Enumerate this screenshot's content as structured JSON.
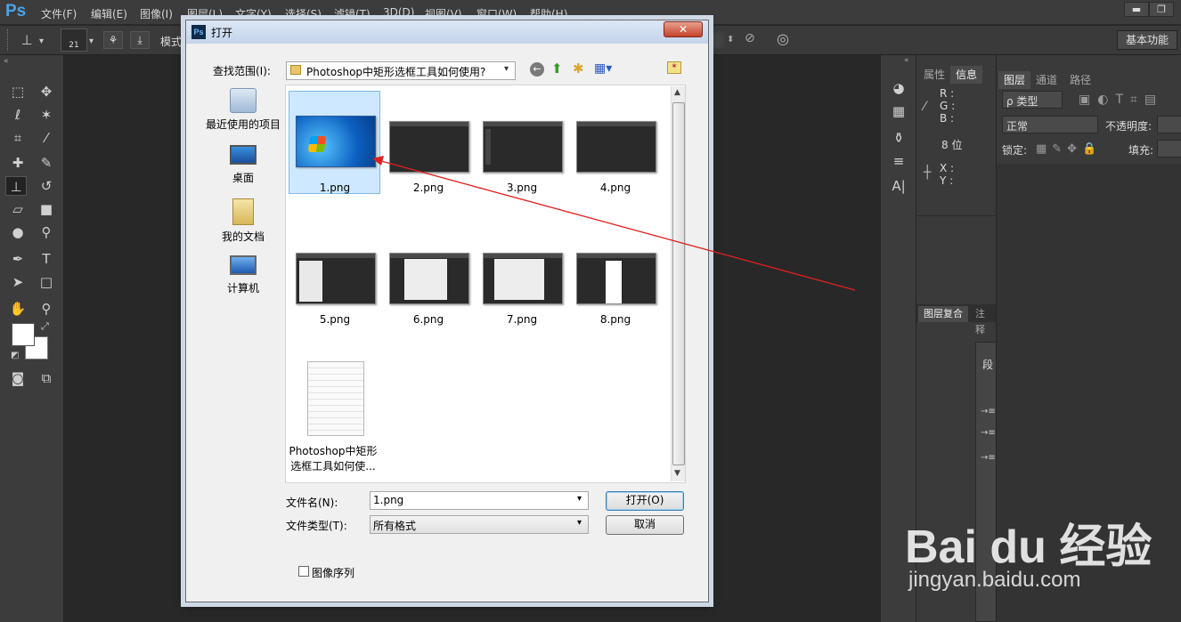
{
  "app": {
    "logo": "Ps",
    "menu": [
      "文件(F)",
      "编辑(E)",
      "图像(I)",
      "图层(L)",
      "文字(Y)",
      "选择(S)",
      "滤镜(T)",
      "3D(D)",
      "视图(V)",
      "窗口(W)",
      "帮助(H)"
    ],
    "minimize": "▬",
    "restore": "❐"
  },
  "options": {
    "brush_size": "21",
    "mode_label": "模式",
    "workspace": "基本功能"
  },
  "panels": {
    "info_tabs": [
      "属性",
      "信息"
    ],
    "info": {
      "r": "R :",
      "g": "G :",
      "b": "B :",
      "bits": "8 位",
      "x": "X :",
      "y": "Y :"
    },
    "layer_tabs": [
      "图层",
      "通道",
      "路径"
    ],
    "layer_kind": "ρ 类型",
    "blend": "正常",
    "opacity_label": "不透明度:",
    "lock_label": "锁定:",
    "fill_label": "填充:",
    "comp_tabs": [
      "图层复合",
      "注释"
    ],
    "para_label": "段"
  },
  "dialog": {
    "title": "打开",
    "close": "✕",
    "lookin_label": "查找范围(I):",
    "lookin_value": "Photoshop中矩形选框工具如何使用?",
    "places": [
      "最近使用的项目",
      "桌面",
      "我的文档",
      "计算机"
    ],
    "files": [
      "1.png",
      "2.png",
      "3.png",
      "4.png",
      "5.png",
      "6.png",
      "7.png",
      "8.png"
    ],
    "doc_name_line1": "Photoshop中矩形",
    "doc_name_line2": "选框工具如何使...",
    "filename_label": "文件名(N):",
    "filename_value": "1.png",
    "filetype_label": "文件类型(T):",
    "filetype_value": "所有格式",
    "open_button": "打开(O)",
    "cancel_button": "取消",
    "image_sequence": "图像序列"
  },
  "watermark": {
    "brand": "Bai du 经验",
    "url": "jingyan.baidu.com"
  },
  "colors": {
    "accent": "#4aa3e8",
    "arrow": "#e02020",
    "selection": "#cde8ff"
  }
}
